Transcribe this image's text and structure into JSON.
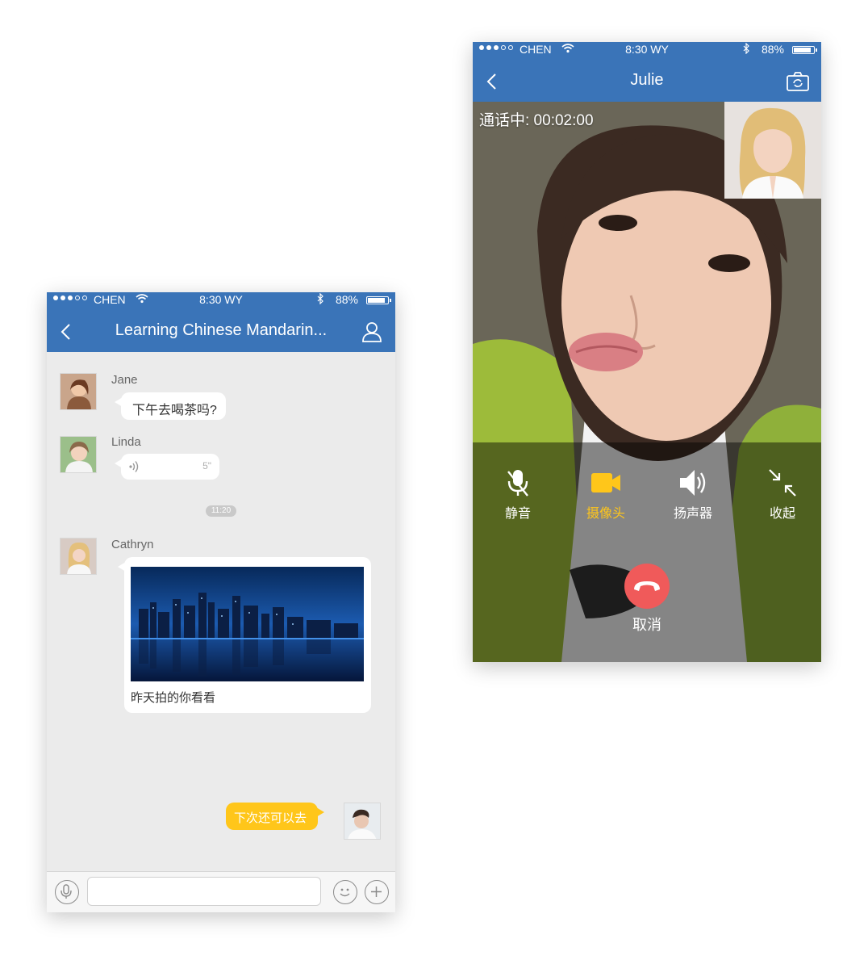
{
  "chat_screen": {
    "status_bar": {
      "carrier": "CHEN",
      "time": "8:30 WY",
      "battery": "88%"
    },
    "header": {
      "title": "Learning Chinese Mandarin..."
    },
    "messages": [
      {
        "sender": "Jane",
        "text": "下午去喝茶吗?"
      },
      {
        "sender": "Linda",
        "voice_duration": "5\""
      },
      {
        "timestamp": "11:20"
      },
      {
        "sender": "Cathryn",
        "caption": "昨天拍的你看看"
      },
      {
        "self_text": "下次还可以去"
      }
    ]
  },
  "call_screen": {
    "status_bar": {
      "carrier": "CHEN",
      "time": "8:30 WY",
      "battery": "88%"
    },
    "header": {
      "title": "Julie"
    },
    "call_status": "通话中: 00:02:00",
    "controls": [
      {
        "label": "静音"
      },
      {
        "label": "摄像头"
      },
      {
        "label": "扬声器"
      },
      {
        "label": "收起"
      }
    ],
    "hangup_label": "取消",
    "colors": {
      "header": "#3a74b8",
      "active_control": "#ffc61a",
      "hangup": "#f05a5a"
    }
  }
}
